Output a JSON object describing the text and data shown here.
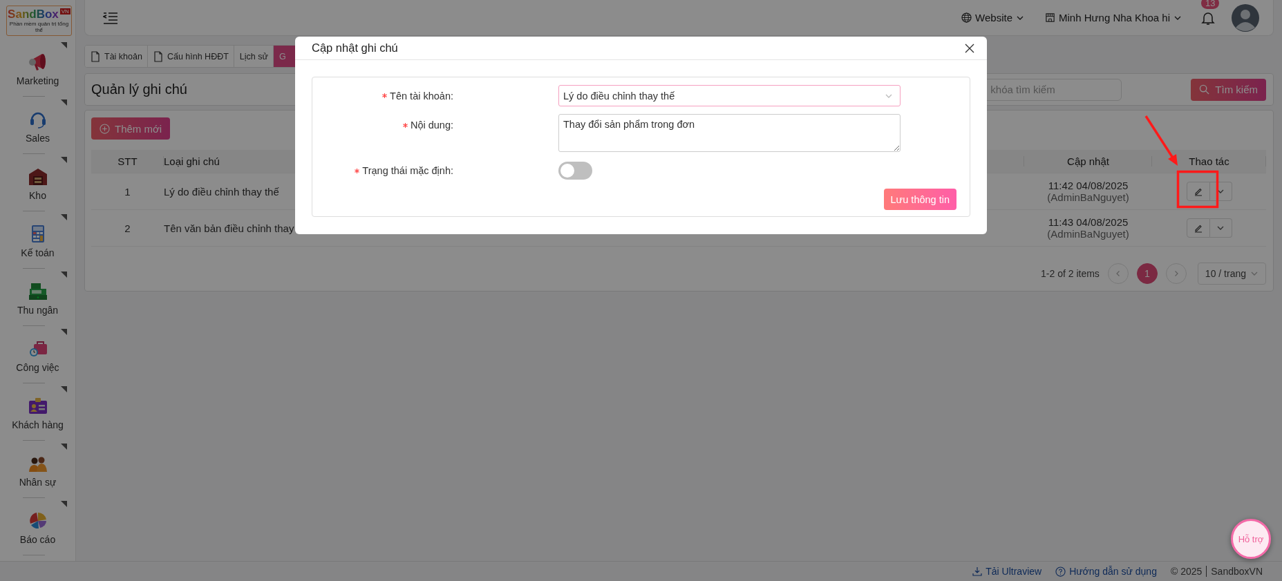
{
  "sidebar": {
    "logo": {
      "name": "SandBox",
      "badge": "VN",
      "tagline": "Phần mềm quản trị tổng thể"
    },
    "items": [
      {
        "label": "Marketing"
      },
      {
        "label": "Sales"
      },
      {
        "label": "Kho"
      },
      {
        "label": "Kế toán"
      },
      {
        "label": "Thu ngân"
      },
      {
        "label": "Công việc"
      },
      {
        "label": "Khách hàng"
      },
      {
        "label": "Nhân sự"
      },
      {
        "label": "Báo cáo"
      }
    ]
  },
  "header": {
    "website": "Website",
    "branch": "Minh Hưng Nha Khoa hi",
    "notification_count": "13"
  },
  "tabs": [
    {
      "label": "Tài khoản",
      "kind": "file",
      "selected": false
    },
    {
      "label": "Cấu hình HĐĐT",
      "kind": "file",
      "selected": false
    },
    {
      "label": "Lịch sử",
      "kind": "plain",
      "selected": false
    },
    {
      "label": "G",
      "kind": "plain",
      "selected": true
    }
  ],
  "page": {
    "title": "Quản lý ghi chú",
    "search_placeholder": "khóa tìm kiếm",
    "search_button": "Tìm kiếm",
    "add_button": "Thêm mới"
  },
  "table": {
    "columns": [
      "STT",
      "Loại ghi chú",
      "Cập nhật",
      "Thao tác"
    ],
    "rows": [
      {
        "stt": "1",
        "type": "Lý do điều chỉnh thay thế",
        "updated": "11:42 04/08/2025",
        "by": "(AdminBaNguyet)"
      },
      {
        "stt": "2",
        "type": "Tên văn bản điều chỉnh thay",
        "updated": "11:43 04/08/2025",
        "by": "(AdminBaNguyet)"
      }
    ]
  },
  "pagination": {
    "summary": "1-2 of 2 items",
    "pages": [
      {
        "label": "1",
        "selected": true
      }
    ],
    "page_size": "10 / trang"
  },
  "footer": {
    "links": [
      "Tải Ultraview",
      "Hướng dẫn sử dụng"
    ],
    "copyright": "© 2025",
    "brand": "SandboxVN"
  },
  "help_button": "Hỗ trợ",
  "modal": {
    "title": "Cập nhật ghi chú",
    "fields": [
      {
        "kind": "select",
        "label": "Tên tài khoản:",
        "required": true,
        "value": "Lý do điều chỉnh thay thế"
      },
      {
        "kind": "textarea",
        "label": "Nội dung:",
        "required": true,
        "value": "Thay đổi sản phẩm trong đơn"
      },
      {
        "kind": "switch",
        "label": "Trạng thái mặc định:",
        "required": true,
        "on": false
      }
    ],
    "save_button": "Lưu thông tin"
  }
}
